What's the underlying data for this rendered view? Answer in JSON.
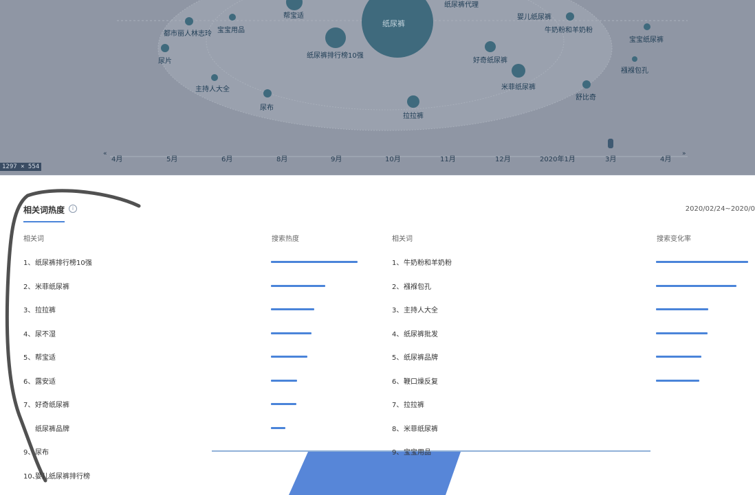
{
  "chart_top": {
    "labels": [
      "纸尿裤",
      "纸尿裤代理",
      "帮宝适",
      "婴儿纸尿裤",
      "都市丽人林志玲",
      "宝宝用品",
      "牛奶粉和羊奶粉",
      "宝宝纸尿裤",
      "纸尿裤排行榜10强",
      "尿片",
      "好奇纸尿裤",
      "襁褓包孔",
      "米菲纸尿裤",
      "主持人大全",
      "舒比奇",
      "尿布",
      "拉拉裤"
    ],
    "months": [
      "4月",
      "5月",
      "6月",
      "8月",
      "9月",
      "10月",
      "11月",
      "12月",
      "2020年1月",
      "3月",
      "4月"
    ],
    "size_badge": "1297 × 554"
  },
  "panel": {
    "title": "相关词热度",
    "date_range": "2020/02/24~2020/0",
    "left_header_word": "相关词",
    "left_header_metric": "搜索热度",
    "right_header_word": "相关词",
    "right_header_metric": "搜索变化率",
    "left_rows": [
      {
        "rank": "1、",
        "word": "纸尿裤排行榜10强",
        "heat": 1.0
      },
      {
        "rank": "2、",
        "word": "米菲纸尿裤",
        "heat": 0.63
      },
      {
        "rank": "3、",
        "word": "拉拉裤",
        "heat": 0.5
      },
      {
        "rank": "4、",
        "word": "尿不湿",
        "heat": 0.47
      },
      {
        "rank": "5、",
        "word": "帮宝适",
        "heat": 0.42
      },
      {
        "rank": "6、",
        "word": "露安适",
        "heat": 0.3
      },
      {
        "rank": "7、",
        "word": "好奇纸尿裤",
        "heat": 0.29
      },
      {
        "rank": "",
        "word": "纸尿裤品牌",
        "heat": 0.17
      },
      {
        "rank": "9、",
        "word": "尿布",
        "heat": 0
      },
      {
        "rank": "10、",
        "word": "婴儿纸尿裤排行榜",
        "heat": 0
      }
    ],
    "right_rows": [
      {
        "rank": "1、",
        "word": "牛奶粉和羊奶粉",
        "rate": 1.0
      },
      {
        "rank": "2、",
        "word": "襁褓包孔",
        "rate": 0.87
      },
      {
        "rank": "3、",
        "word": "主持人大全",
        "rate": 0.57
      },
      {
        "rank": "4、",
        "word": "纸尿裤批发",
        "rate": 0.56
      },
      {
        "rank": "5、",
        "word": "纸尿裤品牌",
        "rate": 0.49
      },
      {
        "rank": "6、",
        "word": "鞭口燥反复",
        "rate": 0.47
      },
      {
        "rank": "7、",
        "word": "拉拉裤",
        "rate": 0
      },
      {
        "rank": "8、",
        "word": "米菲纸尿裤",
        "rate": 0
      },
      {
        "rank": "9、",
        "word": "宝宝用品",
        "rate": 0
      }
    ],
    "accent_color": "#4a84d9"
  }
}
